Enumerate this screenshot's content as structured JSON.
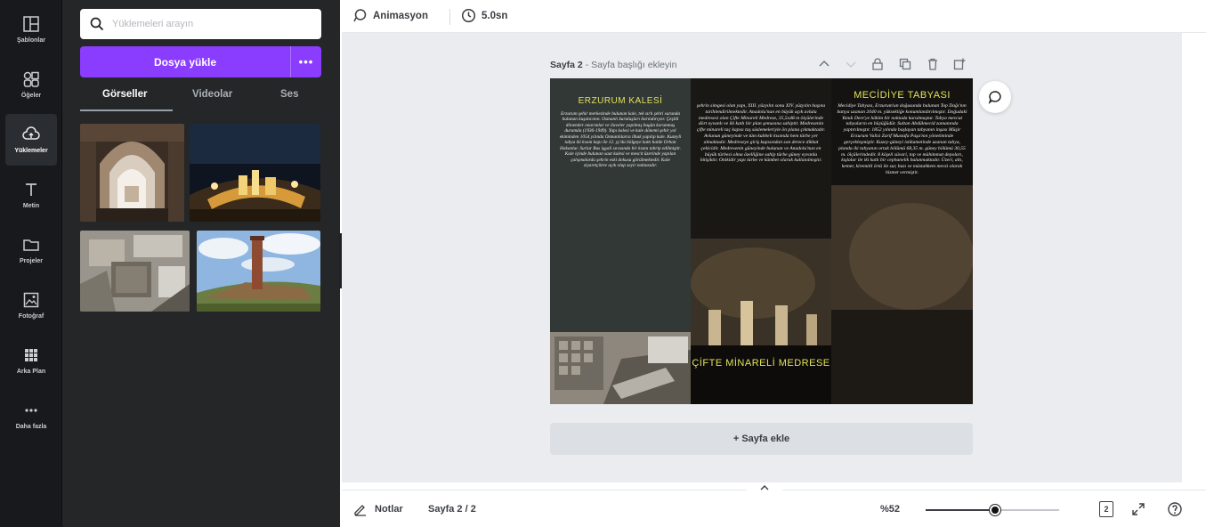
{
  "rail": {
    "items": [
      {
        "label": "Şablonlar",
        "icon": "templates-icon"
      },
      {
        "label": "Öğeler",
        "icon": "elements-icon"
      },
      {
        "label": "Yüklemeler",
        "icon": "uploads-icon",
        "active": true
      },
      {
        "label": "Metin",
        "icon": "text-icon"
      },
      {
        "label": "Projeler",
        "icon": "folder-icon"
      },
      {
        "label": "Fotoğraf",
        "icon": "photo-icon"
      },
      {
        "label": "Arka Plan",
        "icon": "background-icon"
      },
      {
        "label": "Daha fazla",
        "icon": "more-icon"
      }
    ]
  },
  "panel": {
    "search_placeholder": "Yüklemeleri arayın",
    "upload_label": "Dosya yükle",
    "upload_more": "•••",
    "tabs": [
      {
        "label": "Görseller",
        "active": true
      },
      {
        "label": "Videolar",
        "active": false
      },
      {
        "label": "Ses",
        "active": false
      }
    ]
  },
  "toolbar": {
    "animation_label": "Animasyon",
    "duration_label": "5.0sn"
  },
  "canvas": {
    "page_name": "Sayfa 2",
    "page_title_placeholder": " - Sayfa başlığı ekleyin",
    "add_page_label": "+ Sayfa ekle"
  },
  "design": {
    "col1_title": "ERZURUM KALESİ",
    "col1_body": "Erzurum şehir merkezinde bulunan kale, tek sırlı şehri surunda bulunan kuşatıcının. Osmanlı kuruluşları barındırıyor. Çeşitli dönemler onarımlar ve ilaveler yapılmış bugün korunmuş durumda (1936-1949). Yapı kalesi ve kale dönemi şehir yol ekiminden 1054 yılında Osmanlılarca ilhak yapılıp kale. Kuzeyli tabya iki kısım kapı ile 12. yy'da bölgeye kattı halde Orhan Hakanlar. Surlar Rus işgali sırasında bir kısmı tahrip edilmiştir. Kale içinde bulunan saat kulesi ve mescit üzerinde yapılan çalışmalarda şehrin eski dokusu görülmektedir. Kale ziyaretçilere açık olup seyir noktasıdır.",
    "col2_body": "şehrin simgesi olan yapı, XIII. yüzyılın sonu XIV. yüzyılın başına tarihlendirilmektedir. Anadolu'nun en büyük açık avlulu medresesi olan Çifte Minareli Medrese, 35,5x48 m ölçülerinde dört eyvanlı ve iki katlı bir plan şemasına sahiptir. Medresenin çifte minareli taç kapısı taş süslemeleriyle ön plana çıkmaktadır. Avlunun güneyinde ve tüm kubbeli kısımda hem türbe yer almaktadır. Medreseye giriş kapısından son derece dikkat çekicidir. Medresenin güneyinde bulunan ve Anadolu'nun en büyük türbesi olma özelliğine sahip türbe güney eyvanla bitişiktir. Onikidir yapı türbe ve kümbet olarak kullanılmıştır.",
    "col2_title": "ÇİFTE MİNARELİ MEDRESE",
    "col3_title": "MECİDİYE TABYASI",
    "col3_body": "Mecidiye Tabyası, Erzurum'un doğusunda bulunan Top Dağı'nın batıya uzanan 2040 m. yüksekliğe konumlandırılmıştır. Doğudaki Yandı Dere'ye hâkim bir noktada kurulmuştur. Tabya mevcut tabyaların en büyüğüdür. Sultan Abdülmecid zamanında yaptırılmıştır. 1852 yılında başlayan tabyanın inşası Müşir Erzurum Valisi Zarif Mustafa Paşa'nın yönetiminde gerçekleşmiştir. Kuzey-güneyi istikametinde uzanan tabya, planda iki tabyanın ortak bölümü 68,35 m. güney bölümü 30,55 m. ölçülerindedir. 8 köşeli süvari, top ve mühimmat depoları, kışlalar ile iki katlı bir cephanelik bulunmaktadır. Üzeri, altı, kemer, kiremitli örtü ile sur, bazı ve müstahkem mevzi olarak hizmet vermiştir."
  },
  "bottombar": {
    "notes_label": "Notlar",
    "page_indicator": "Sayfa 2 / 2",
    "zoom_label": "%52",
    "page_count_badge": "2"
  },
  "zoom": {
    "level_fraction": 0.52
  },
  "colors": {
    "accent": "#8b3dff",
    "rail_bg": "#17191c",
    "panel_bg": "#252627",
    "canvas_bg": "#eaecef",
    "design_title": "#e3e35a"
  }
}
